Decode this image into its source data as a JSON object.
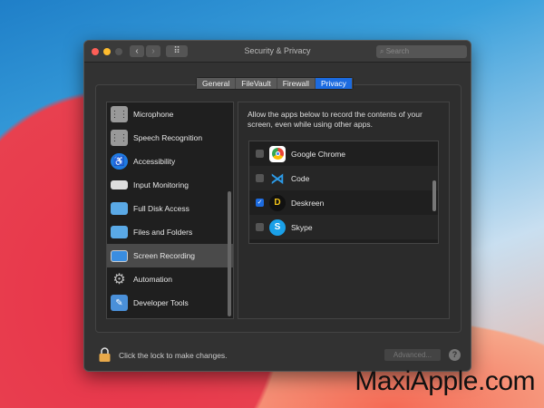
{
  "window": {
    "title": "Security & Privacy",
    "search_placeholder": "Search",
    "back": "‹",
    "forward": "›",
    "grid": "⠿"
  },
  "tabs": [
    {
      "label": "General"
    },
    {
      "label": "FileVault"
    },
    {
      "label": "Firewall"
    },
    {
      "label": "Privacy",
      "selected": true
    }
  ],
  "sidebar": {
    "items": [
      {
        "label": "Microphone",
        "icon": "waveform-icon"
      },
      {
        "label": "Speech Recognition",
        "icon": "waveform-icon"
      },
      {
        "label": "Accessibility",
        "icon": "accessibility-icon"
      },
      {
        "label": "Input Monitoring",
        "icon": "keyboard-icon"
      },
      {
        "label": "Full Disk Access",
        "icon": "folder-icon"
      },
      {
        "label": "Files and Folders",
        "icon": "folder-icon"
      },
      {
        "label": "Screen Recording",
        "icon": "display-icon",
        "selected": true
      },
      {
        "label": "Automation",
        "icon": "gear-icon"
      },
      {
        "label": "Developer Tools",
        "icon": "tools-icon"
      }
    ]
  },
  "main": {
    "description": "Allow the apps below to record the contents of your screen, even while using other apps.",
    "apps": [
      {
        "name": "Google Chrome",
        "checked": false
      },
      {
        "name": "Code",
        "checked": false
      },
      {
        "name": "Deskreen",
        "checked": true
      },
      {
        "name": "Skype",
        "checked": false
      }
    ]
  },
  "footer": {
    "lock_text": "Click the lock to make changes.",
    "advanced": "Advanced...",
    "help": "?"
  },
  "watermark": "MaxiApple.com"
}
